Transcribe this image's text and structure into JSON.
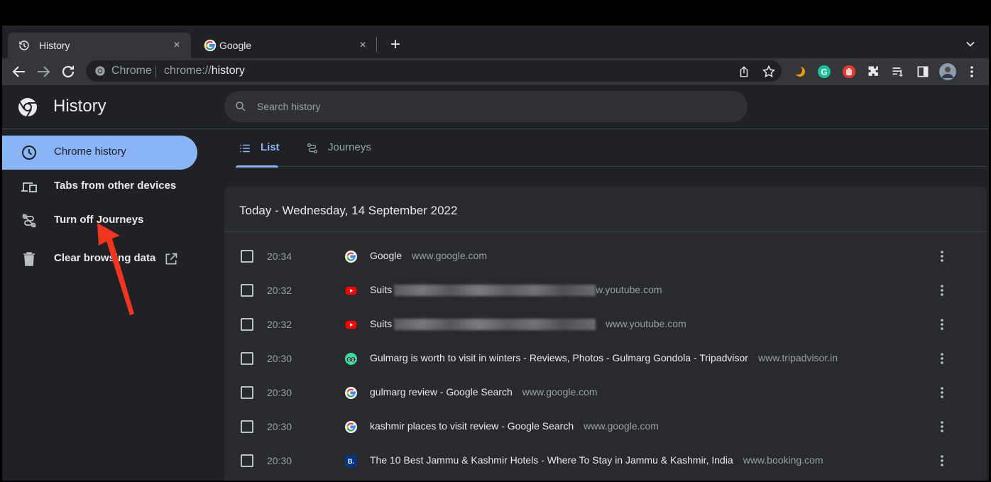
{
  "browser": {
    "tabs": [
      {
        "title": "History",
        "active": true
      },
      {
        "title": "Google",
        "active": false
      }
    ],
    "new_tab_symbol": "+",
    "close_symbol": "×",
    "omnibox": {
      "chip": "Chrome",
      "url_prefix": "chrome://",
      "url_host": "history"
    }
  },
  "page": {
    "title": "History",
    "search": {
      "placeholder": "Search history"
    }
  },
  "sidebar": {
    "items": [
      {
        "label": "Chrome history",
        "icon": "clock-icon",
        "selected": true
      },
      {
        "label": "Tabs from other devices",
        "icon": "devices-icon",
        "selected": false
      },
      {
        "label": "Turn off Journeys",
        "icon": "journeys-off-icon",
        "selected": false
      },
      {
        "label": "Clear browsing data",
        "icon": "trash-icon",
        "selected": false
      }
    ]
  },
  "view_tabs": [
    {
      "label": "List",
      "icon": "list-icon",
      "active": true
    },
    {
      "label": "Journeys",
      "icon": "journeys-icon",
      "active": false
    }
  ],
  "history": {
    "date_heading": "Today - Wednesday, 14 September 2022",
    "entries": [
      {
        "time": "20:34",
        "title": "Google",
        "url": "www.google.com",
        "favicon": "google-favicon"
      },
      {
        "time": "20:32",
        "title": "Suits",
        "url": "w.youtube.com",
        "favicon": "youtube-favicon",
        "redacted": true
      },
      {
        "time": "20:32",
        "title": "Suits",
        "url": "www.youtube.com",
        "favicon": "youtube-favicon",
        "redacted": true
      },
      {
        "time": "20:30",
        "title": "Gulmarg is worth to visit in winters - Reviews, Photos - Gulmarg Gondola - Tripadvisor",
        "url": "www.tripadvisor.in",
        "favicon": "tripadvisor-favicon"
      },
      {
        "time": "20:30",
        "title": "gulmarg review - Google Search",
        "url": "www.google.com",
        "favicon": "google-favicon"
      },
      {
        "time": "20:30",
        "title": "kashmir places to visit review - Google Search",
        "url": "www.google.com",
        "favicon": "google-favicon"
      },
      {
        "time": "20:30",
        "title": "The 10 Best Jammu & Kashmir Hotels - Where To Stay in Jammu & Kashmir, India",
        "url": "www.booking.com",
        "favicon": "booking-favicon",
        "favicon_text": "B."
      }
    ]
  },
  "colors": {
    "accent": "#8ab4f8",
    "background": "#202124",
    "card": "#292a2d",
    "annotation_arrow": "#f2351f"
  }
}
